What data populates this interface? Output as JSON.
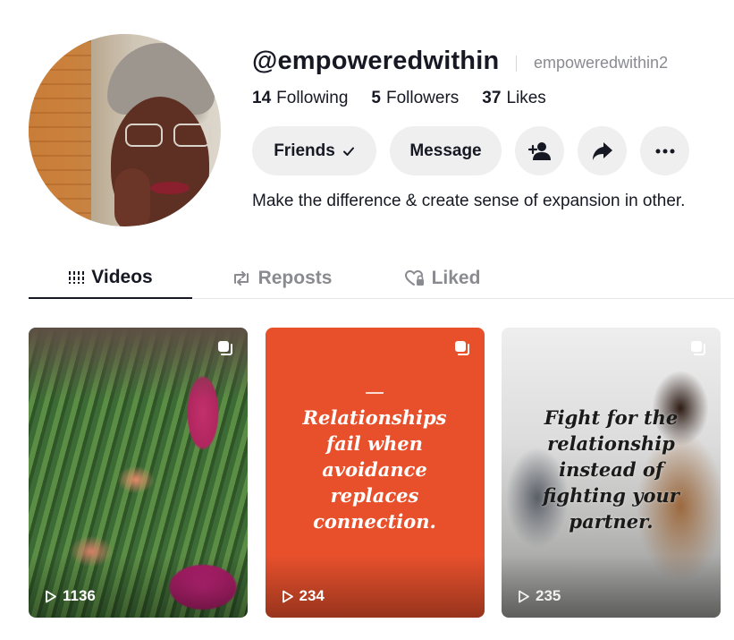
{
  "profile": {
    "username": "@empoweredwithin",
    "nickname": "empoweredwithin2",
    "bio": "Make the difference & create sense of expansion in other.",
    "stats": [
      {
        "value": "14",
        "label": "Following"
      },
      {
        "value": "5",
        "label": "Followers"
      },
      {
        "value": "37",
        "label": "Likes"
      }
    ]
  },
  "actions": {
    "friends_label": "Friends",
    "message_label": "Message",
    "icons": [
      "add-friend-icon",
      "share-icon",
      "more-icon"
    ]
  },
  "tabs": [
    {
      "label": "Videos",
      "icon": "grid-bars-icon",
      "active": true
    },
    {
      "label": "Reposts",
      "icon": "repost-icon",
      "active": false
    },
    {
      "label": "Liked",
      "icon": "heart-lock-icon",
      "active": false
    }
  ],
  "videos": [
    {
      "views": "1136",
      "overlay": []
    },
    {
      "views": "234",
      "overlay": [
        "Relationships",
        "fail when",
        "avoidance",
        "replaces",
        "connection."
      ]
    },
    {
      "views": "235",
      "overlay": [
        "Fight for the",
        "relationship",
        "instead of",
        "fighting your",
        "partner."
      ]
    }
  ],
  "colors": {
    "text_primary": "#161823",
    "text_secondary": "#8a8b91",
    "button_bg": "#efefef",
    "card2_bg": "#e8502c"
  }
}
